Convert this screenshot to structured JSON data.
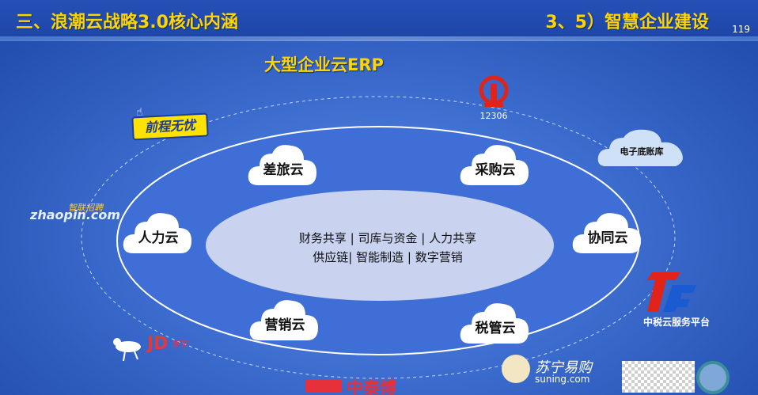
{
  "header": {
    "title_left": "三、浪潮云战略3.0核心内涵",
    "title_right": "3、5）智慧企业建设",
    "page_number": "119"
  },
  "erp_title": "大型企业云ERP",
  "core": {
    "line1": "财务共享 | 司库与资金 | 人力共享",
    "line2": "供应链|  智能制造   | 数字营销"
  },
  "clouds": {
    "travel": "差旅云",
    "procurement": "采购云",
    "hr": "人力云",
    "collab": "协同云",
    "marketing": "营销云",
    "tax": "税管云"
  },
  "partners": {
    "job51": "前程无忧",
    "zhaopin": "zhaopin.com",
    "zhaopin_cn": "智联招聘",
    "rail": "12306",
    "e_ledger": "电子底账库",
    "tax_platform": "中税云服务平台",
    "jd": "JD",
    "jd_cn": "京东",
    "zhongtai": "中泰博",
    "suning_cn": "苏宁易购",
    "suning_en": "suning.com"
  },
  "colors": {
    "accent_yellow": "#ffd400",
    "background_blue": "#2a58bf",
    "inner_ellipse": "#c9d3f0"
  }
}
